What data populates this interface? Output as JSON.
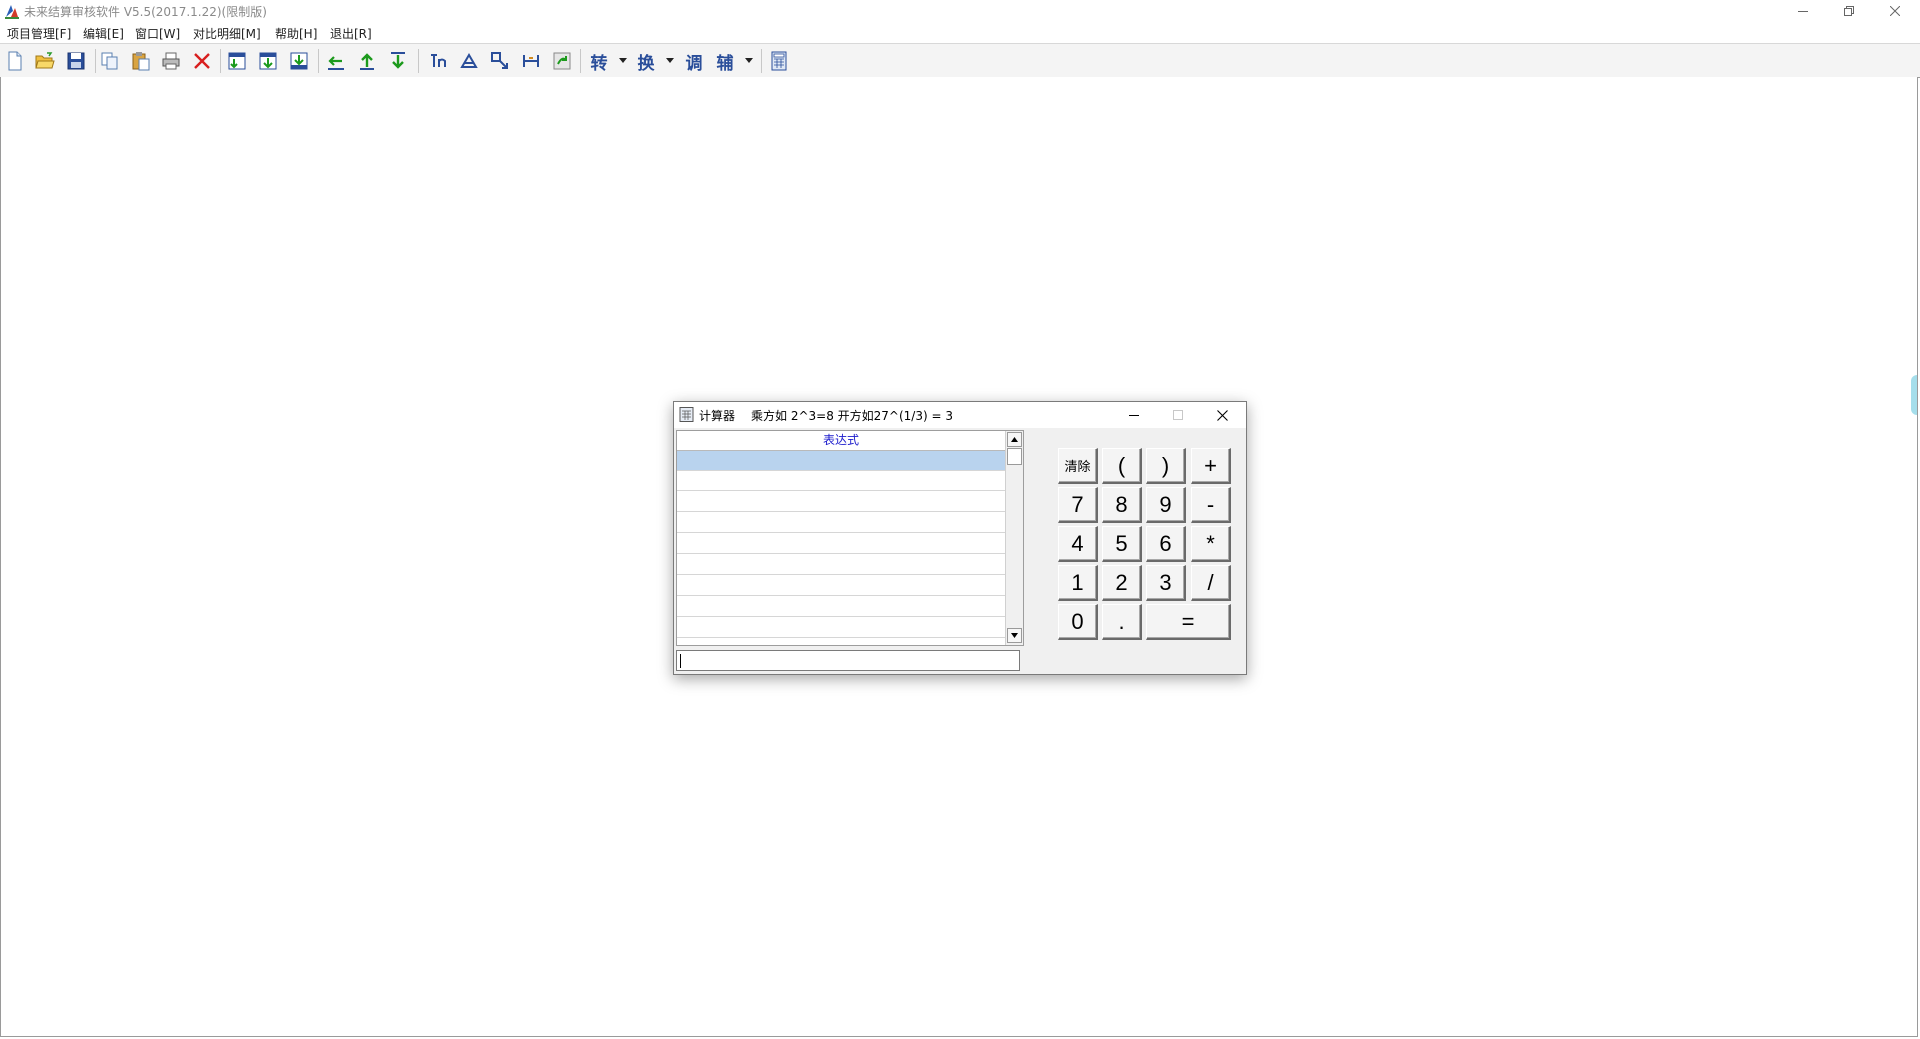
{
  "window": {
    "title": "未来结算审核软件 V5.5(2017.1.22)(限制版)"
  },
  "menu": {
    "items": [
      {
        "label": "项目管理[F]"
      },
      {
        "label": "编辑[E]"
      },
      {
        "label": "窗口[W]"
      },
      {
        "label": "对比明细[M]"
      },
      {
        "label": "帮助[H]"
      },
      {
        "label": "退出[R]"
      }
    ]
  },
  "toolbar": {
    "icons": [
      "new-file-icon",
      "open-folder-icon",
      "save-icon",
      "copy-icon",
      "paste-icon",
      "print-icon",
      "delete-icon",
      "insert-row-icon",
      "insert-below-icon",
      "insert-down-icon",
      "indent-icon",
      "move-up-icon",
      "move-down-icon",
      "quantity-icon",
      "find-icon",
      "replace-icon",
      "measure-icon",
      "refresh-icon"
    ],
    "dropdowns": [
      {
        "label": "转"
      },
      {
        "label": "换"
      }
    ],
    "text_buttons": [
      {
        "label": "调"
      }
    ],
    "dropdown_last": {
      "label": "辅"
    },
    "calculator_icon": "calculator-icon"
  },
  "calculator": {
    "title": "计算器",
    "hint": "乘方如 2^3=8 开方如27^(1/3) = 3",
    "list_header": "表达式",
    "expression_value": "",
    "keys": {
      "clear": "清除",
      "lparen": "(",
      "rparen": ")",
      "plus": "+",
      "seven": "7",
      "eight": "8",
      "nine": "9",
      "minus": "-",
      "four": "4",
      "five": "5",
      "six": "6",
      "multiply": "*",
      "one": "1",
      "two": "2",
      "three": "3",
      "divide": "/",
      "zero": "0",
      "dot": ".",
      "equals": "="
    }
  },
  "colors": {
    "selected_row": "#b9d3ee",
    "header_text": "#1b1bcc"
  }
}
